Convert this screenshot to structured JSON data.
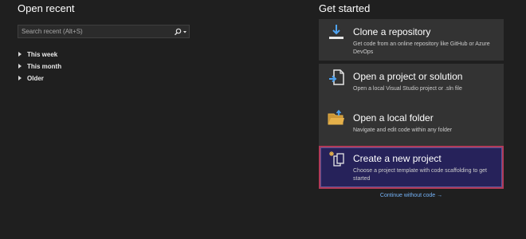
{
  "open_recent": {
    "title": "Open recent",
    "search": {
      "placeholder": "Search recent (Alt+S)",
      "icon": "search-icon"
    },
    "groups": [
      {
        "label": "This week"
      },
      {
        "label": "This month"
      },
      {
        "label": "Older"
      }
    ]
  },
  "get_started": {
    "title": "Get started",
    "cards": [
      {
        "title": "Clone a repository",
        "description": "Get code from an online repository like GitHub or Azure DevOps",
        "icon": "clone-repo-icon"
      },
      {
        "title": "Open a project or solution",
        "description": "Open a local Visual Studio project or .sln file",
        "icon": "open-project-icon"
      },
      {
        "title": "Open a local folder",
        "description": "Navigate and edit code within any folder",
        "icon": "folder-icon"
      },
      {
        "title": "Create a new project",
        "description": "Choose a project template with code scaffolding to get started",
        "icon": "new-project-icon"
      }
    ],
    "continue_label": "Continue without code →"
  },
  "colors": {
    "background": "#1f1f1f",
    "card": "#333333",
    "highlight_card": "#26225a",
    "highlight_border": "#b13a59",
    "link": "#74b2f6",
    "accent_blue": "#4ea3f1",
    "folder_yellow": "#e4b04a"
  }
}
